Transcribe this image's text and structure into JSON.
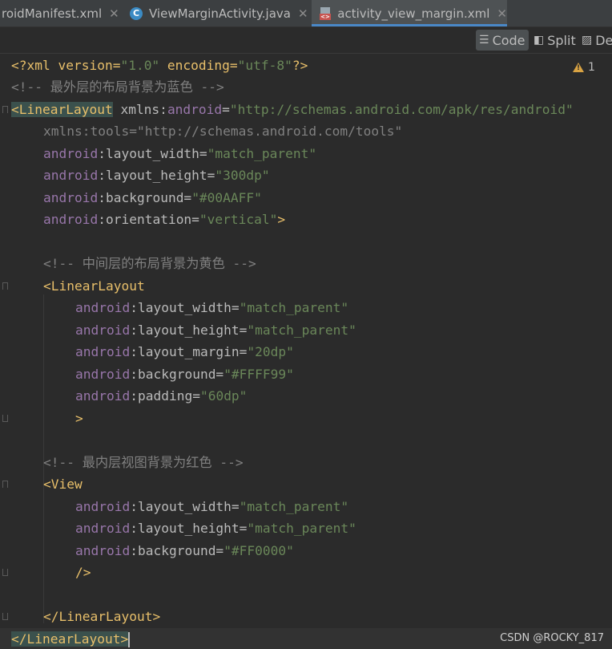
{
  "tabs": [
    {
      "label": "roidManifest.xml",
      "icon": "none",
      "active": false
    },
    {
      "label": "ViewMarginActivity.java",
      "icon": "java-class-icon",
      "active": false
    },
    {
      "label": "activity_view_margin.xml",
      "icon": "xml-layout-icon",
      "active": true
    }
  ],
  "tab_close_glyph": "✕",
  "toolbar": {
    "code_label": "Code",
    "split_label": "Split",
    "design_label": "De"
  },
  "inspection": {
    "warning_count": "1"
  },
  "code": {
    "l1": {
      "a": "<?xml version=",
      "b": "\"1.0\"",
      "c": " encoding=",
      "d": "\"utf-8\"",
      "e": "?>"
    },
    "l2": "<!-- 最外层的布局背景为蓝色 -->",
    "l3": {
      "tag": "<LinearLayout",
      "attr": " xmlns:",
      "ns": "android",
      "eq": "=",
      "val": "\"http://schemas.android.com/apk/res/android\""
    },
    "l4": "xmlns:tools=\"http://schemas.android.com/tools\"",
    "l5": {
      "ns": "android",
      "attr": ":layout_width=",
      "val": "\"match_parent\""
    },
    "l6": {
      "ns": "android",
      "attr": ":layout_height=",
      "val": "\"300dp\""
    },
    "l7": {
      "ns": "android",
      "attr": ":background=",
      "val": "\"#00AAFF\""
    },
    "l8": {
      "ns": "android",
      "attr": ":orientation=",
      "val": "\"vertical\"",
      "close": ">"
    },
    "l10": "<!-- 中间层的布局背景为黄色 -->",
    "l11": "<LinearLayout",
    "l12": {
      "ns": "android",
      "attr": ":layout_width=",
      "val": "\"match_parent\""
    },
    "l13": {
      "ns": "android",
      "attr": ":layout_height=",
      "val": "\"match_parent\""
    },
    "l14": {
      "ns": "android",
      "attr": ":layout_margin=",
      "val": "\"20dp\""
    },
    "l15": {
      "ns": "android",
      "attr": ":background=",
      "val": "\"#FFFF99\""
    },
    "l16": {
      "ns": "android",
      "attr": ":padding=",
      "val": "\"60dp\""
    },
    "l17": ">",
    "l19": "<!-- 最内层视图背景为红色 -->",
    "l20": "<View",
    "l21": {
      "ns": "android",
      "attr": ":layout_width=",
      "val": "\"match_parent\""
    },
    "l22": {
      "ns": "android",
      "attr": ":layout_height=",
      "val": "\"match_parent\""
    },
    "l23": {
      "ns": "android",
      "attr": ":background=",
      "val": "\"#FF0000\""
    },
    "l24": "/>",
    "l26": "</LinearLayout>",
    "l27": "</LinearLayout>"
  },
  "watermark": "CSDN @ROCKY_817",
  "colors": {
    "editor_bg": "#2b2b2b",
    "tag": "#e8bf6a",
    "namespace": "#9876aa",
    "string": "#6a8759",
    "comment": "#808080",
    "active_tab_underline": "#4a88c7"
  }
}
